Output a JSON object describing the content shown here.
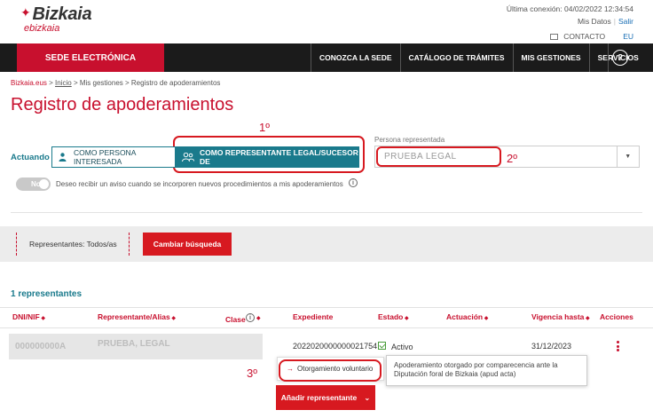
{
  "header": {
    "brand": "Bizkaia",
    "brand_sub": "ebizkaia",
    "last_connection": "Última conexión: 04/02/2022 12:34:54",
    "mis_datos": "Mis Datos",
    "salir": "Salir",
    "contacto": "CONTACTO",
    "lang": "EU"
  },
  "nav": {
    "sede": "SEDE ELECTRÓNICA",
    "items": [
      "CONOZCA LA SEDE",
      "CATÁLOGO DE TRÁMITES",
      "MIS GESTIONES",
      "SERVICIOS"
    ],
    "help": "?"
  },
  "breadcrumb": {
    "home": "Bizkaia.eus",
    "sep": " > ",
    "inicio": "Inicio",
    "mis_gestiones": "Mis gestiones",
    "current": "Registro de apoderamientos"
  },
  "page": {
    "title": "Registro de apoderamientos"
  },
  "annotations": {
    "a1": "1º",
    "a2": "2º",
    "a3": "3º"
  },
  "actuando": {
    "label": "Actuando",
    "option_interesada": "COMO PERSONA INTERESADA",
    "option_representante": "COMO REPRESENTANTE LEGAL/SUCESOR DE"
  },
  "persona": {
    "label": "Persona representada",
    "value": "PRUEBA LEGAL"
  },
  "aviso": {
    "toggle": "No",
    "text": "Deseo recibir un aviso cuando se incorporen nuevos procedimientos a mis apoderamientos"
  },
  "filter": {
    "representantes": "Representantes: Todos/as",
    "cambiar": "Cambiar búsqueda"
  },
  "results": {
    "count": "1 representantes",
    "columns": [
      "DNI/NIF",
      "Representante/Alias",
      "Clase",
      "Expediente",
      "Estado",
      "Actuación",
      "Vigencia hasta",
      "Acciones"
    ],
    "row": {
      "dni": "000000000A",
      "representante": "PRUEBA, LEGAL",
      "expediente": "2022020000000021754",
      "estado": "Activo",
      "vigencia": "31/12/2023"
    }
  },
  "dropdown": {
    "item": "Otorgamiento voluntario"
  },
  "tooltip": {
    "text": "Apoderamiento otorgado por comparecencia ante la Diputación foral de Bizkaia (apud acta)"
  },
  "actions": {
    "anadir": "Añadir representante"
  },
  "colors": {
    "brand_red": "#c8102e",
    "teal": "#1a7a8c",
    "nav_bg": "#1b1b1b"
  }
}
